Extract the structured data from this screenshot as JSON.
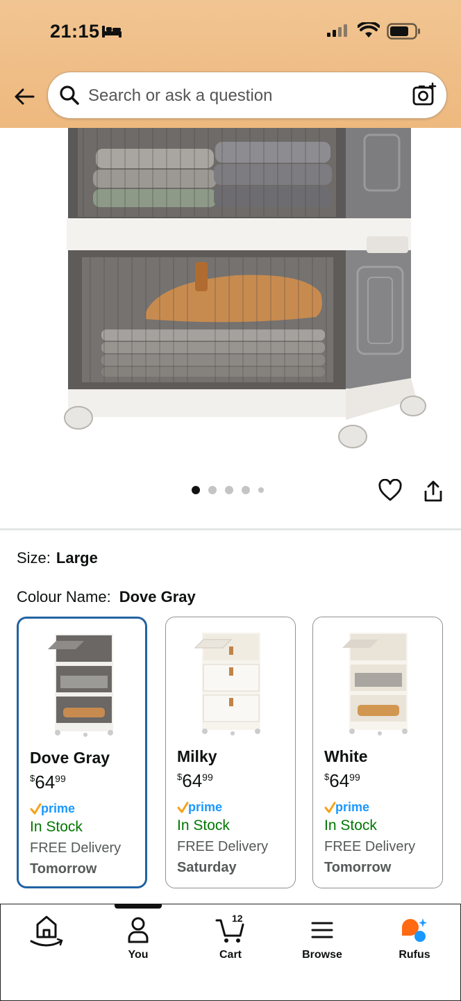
{
  "status_bar": {
    "time": "21:15"
  },
  "header": {
    "search_placeholder": "Search or ask a question"
  },
  "gallery": {
    "image_count": 5,
    "active_index": 0
  },
  "variation": {
    "size_label": "Size:",
    "size_value": "Large",
    "colour_label": "Colour Name:",
    "colour_value": "Dove Gray"
  },
  "swatches": [
    {
      "name": "Dove Gray",
      "currency": "$",
      "price_whole": "64",
      "price_fraction": "99",
      "prime": "prime",
      "stock": "In Stock",
      "delivery": "FREE Delivery",
      "day": "Tomorrow"
    },
    {
      "name": "Milky",
      "currency": "$",
      "price_whole": "64",
      "price_fraction": "99",
      "prime": "prime",
      "stock": "In Stock",
      "delivery": "FREE Delivery",
      "day": "Saturday"
    },
    {
      "name": "White",
      "currency": "$",
      "price_whole": "64",
      "price_fraction": "99",
      "prime": "prime",
      "stock": "In Stock",
      "delivery": "FREE Delivery",
      "day": "Tomorrow"
    }
  ],
  "bottom_nav": {
    "you": "You",
    "cart": "Cart",
    "cart_count": "12",
    "browse": "Browse",
    "rufus": "Rufus"
  },
  "colors": {
    "header_bg": "#f1c592",
    "selected_border": "#2162a1",
    "in_stock": "#007600",
    "prime_blue": "#1a98ff",
    "prime_check": "#f7a11b",
    "rufus_orange": "#ff6a13"
  }
}
